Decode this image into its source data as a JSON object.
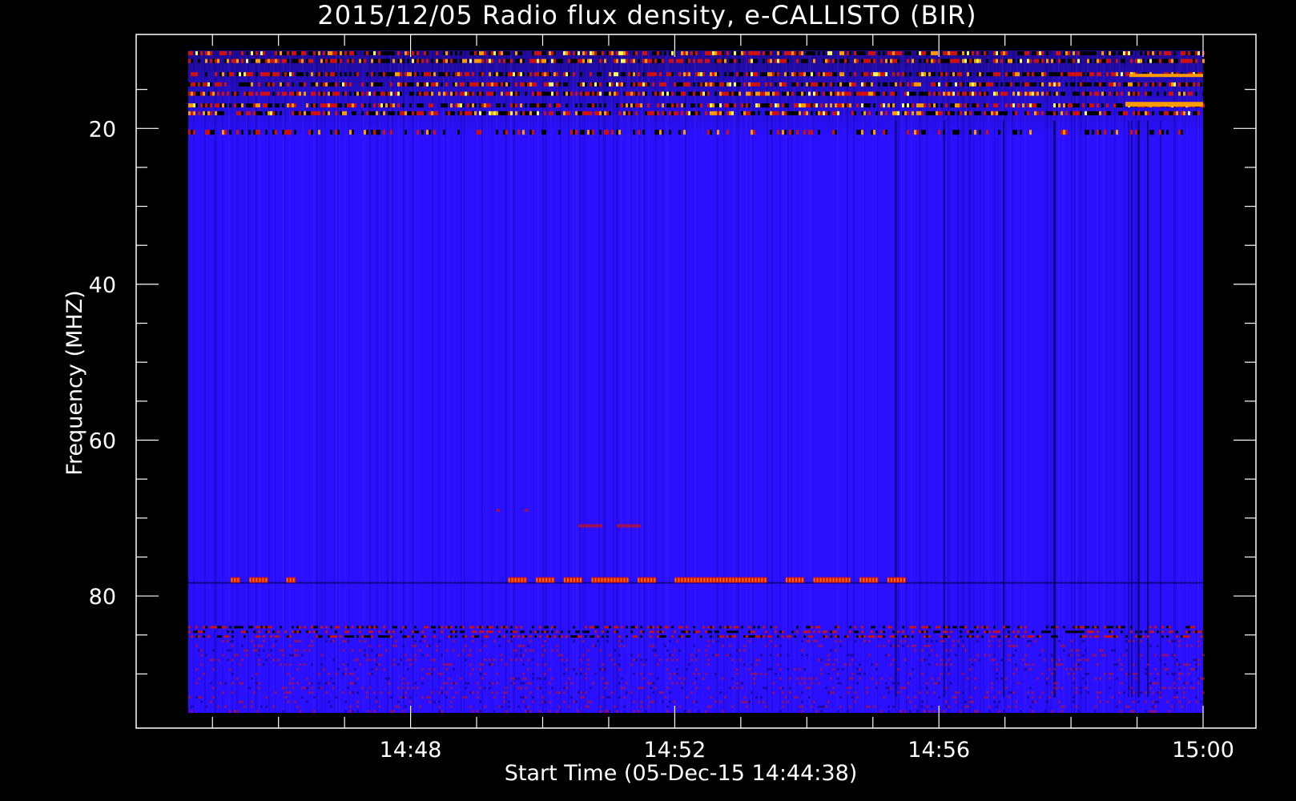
{
  "chart_data": {
    "type": "heatmap",
    "title": "2015/12/05  Radio flux density, e-CALLISTO (BIR)",
    "xlabel": "Start Time (05-Dec-15 14:44:38)",
    "ylabel": "Frequency (MHZ)",
    "x_range": [
      "14:44:38",
      "15:00:00"
    ],
    "y_range": [
      10,
      95
    ],
    "y_inverted": true,
    "x_ticks": [
      "14:48",
      "14:52",
      "14:56",
      "15:00"
    ],
    "y_ticks": [
      20,
      40,
      60,
      80
    ],
    "colormap": [
      "#000000",
      "#2a10ff",
      "#d01010",
      "#ff9a00",
      "#ffff66"
    ],
    "background_level_color": "#2a10ff",
    "features": [
      {
        "label": "interference bands",
        "freq_mhz": [
          10,
          18
        ],
        "level": "high"
      },
      {
        "label": "narrowband signal",
        "freq_mhz": 20.5,
        "level": "medium-high"
      },
      {
        "label": "narrowband signal",
        "freq_mhz": 78,
        "time_span": [
          "14:45:00",
          "14:55:30"
        ],
        "level": "medium"
      },
      {
        "label": "noisy band",
        "freq_mhz": [
          84,
          95
        ],
        "level": "medium"
      }
    ]
  }
}
